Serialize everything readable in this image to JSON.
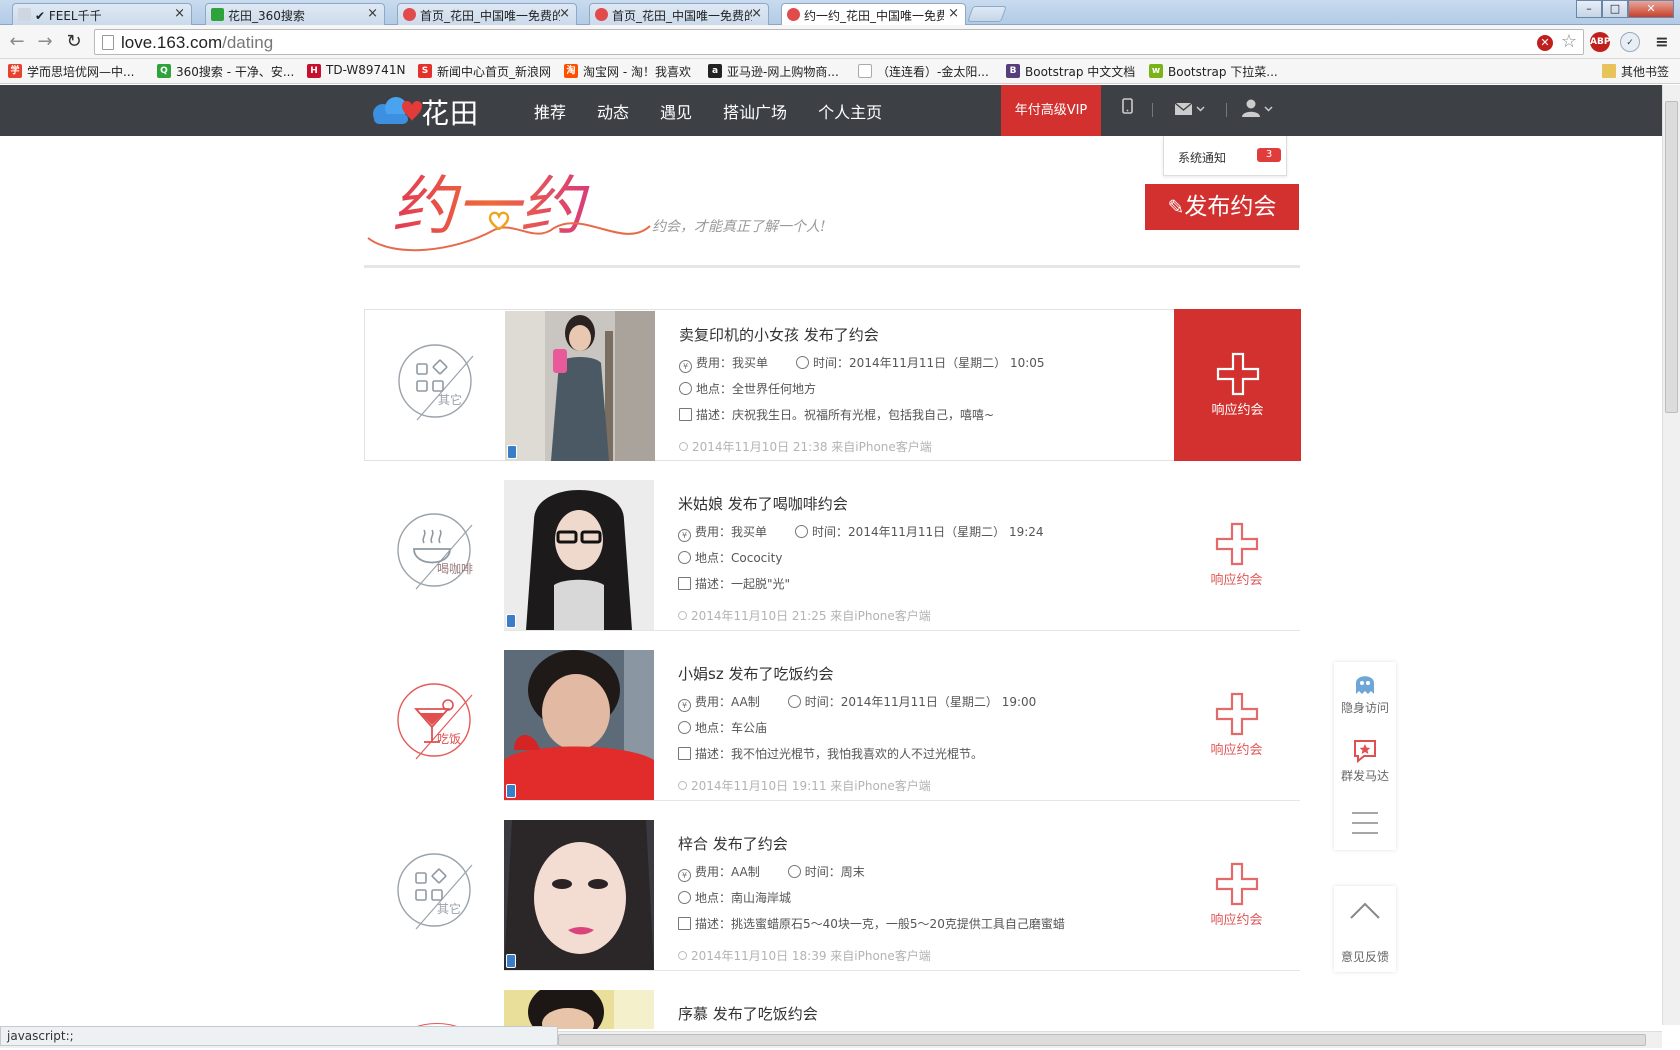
{
  "browser": {
    "tabs": [
      {
        "label": "✔ FEEL千千",
        "fav": "#cfd6df"
      },
      {
        "label": "花田_360搜索",
        "fav": "#2fa33b"
      },
      {
        "label": "首页_花田_中国唯一免费的",
        "fav": "#e14b4b"
      },
      {
        "label": "首页_花田_中国唯一免费的",
        "fav": "#e14b4b"
      },
      {
        "label": "约一约_花田_中国唯一免费",
        "fav": "#e14b4b"
      }
    ],
    "url_host": "love.163.com",
    "url_path": "/dating",
    "bookmarks": [
      {
        "label": "学而思培优网—中...",
        "color": "#e8412e",
        "icon": "学"
      },
      {
        "label": "360搜索 - 干净、安...",
        "color": "#2fa33b",
        "icon": "Q"
      },
      {
        "label": "TD-W89741N",
        "color": "#c8102e",
        "icon": "H"
      },
      {
        "label": "新闻中心首页_新浪网",
        "color": "#e4312b",
        "icon": "S"
      },
      {
        "label": "淘宝网 - 淘！我喜欢",
        "color": "#ff5000",
        "icon": "淘"
      },
      {
        "label": "亚马逊-网上购物商...",
        "color": "#222222",
        "icon": "a"
      },
      {
        "label": "（连连看）-金太阳...",
        "color": "#cccccc",
        "icon": ""
      },
      {
        "label": "Bootstrap 中文文档",
        "color": "#563d7c",
        "icon": "B"
      },
      {
        "label": "Bootstrap 下拉菜...",
        "color": "#7ab317",
        "icon": "w"
      }
    ],
    "other_bookmarks": "其他书签",
    "status_text": "javascript:;"
  },
  "header": {
    "logo_text": "花田",
    "nav": [
      "推荐",
      "动态",
      "遇见",
      "搭讪广场",
      "个人主页"
    ],
    "vip_label": "年付高级VIP",
    "notification_label": "系统通知",
    "notification_count": "3"
  },
  "banner": {
    "title": "约一约",
    "slogan": "约会，才能真正了解一个人!",
    "publish_label": "发布约会"
  },
  "labels": {
    "fee": "费用：",
    "time": "时间：",
    "place": "地点：",
    "desc": "描述：",
    "respond": "响应约会"
  },
  "items": [
    {
      "category": "其它",
      "title": "卖复印机的小女孩 发布了约会",
      "fee": "我买单",
      "time": "2014年11月11日（星期二） 10:05",
      "place": "全世界任何地方",
      "desc": "庆祝我生日。祝福所有光棍，包括我自己，嘻嘻~",
      "meta": "2014年11月10日 21:38  来自iPhone客户端"
    },
    {
      "category": "喝咖啡",
      "title": "米姑娘 发布了喝咖啡约会",
      "fee": "我买单",
      "time": "2014年11月11日（星期二） 19:24",
      "place": "Cococity",
      "desc": "一起脱\"光\"",
      "meta": "2014年11月10日 21:25  来自iPhone客户端"
    },
    {
      "category": "吃饭",
      "title": "小娟sz 发布了吃饭约会",
      "fee": "AA制",
      "time": "2014年11月11日（星期二） 19:00",
      "place": "车公庙",
      "desc": "我不怕过光棍节，我怕我喜欢的人不过光棍节。",
      "meta": "2014年11月10日 19:11  来自iPhone客户端"
    },
    {
      "category": "其它",
      "title": "梓合 发布了约会",
      "fee": "AA制",
      "time": "周末",
      "place": "南山海岸城",
      "desc": "挑选蜜蜡原石5～40块一克，一般5～20克提供工具自己磨蜜蜡",
      "meta": "2014年11月10日 18:39  来自iPhone客户端"
    },
    {
      "title": "序慕 发布了吃饭约会"
    }
  ],
  "floating": {
    "stealth": "隐身访问",
    "radar": "群发马达",
    "feedback": "意见反馈"
  },
  "colors": {
    "accent": "#d2312f",
    "header_bg": "#3d4146"
  }
}
